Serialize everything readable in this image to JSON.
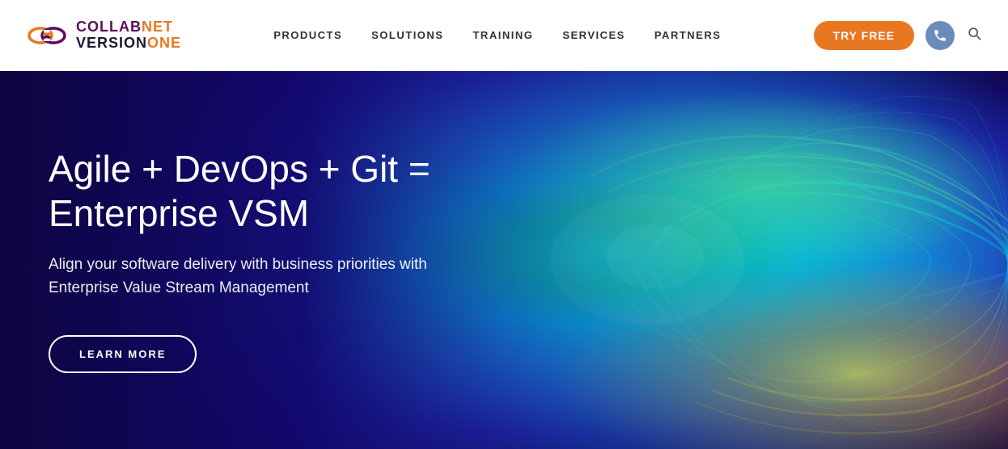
{
  "header": {
    "logo": {
      "collab": "COLLAB",
      "net": "NET",
      "version": "VERSION",
      "one": "ONE"
    },
    "nav": {
      "items": [
        {
          "label": "PRODUCTS",
          "id": "products"
        },
        {
          "label": "SOLUTIONS",
          "id": "solutions"
        },
        {
          "label": "TRAINING",
          "id": "training"
        },
        {
          "label": "SERVICES",
          "id": "services"
        },
        {
          "label": "PARTNERS",
          "id": "partners"
        }
      ]
    },
    "try_free_label": "TRY FREE",
    "phone_icon": "phone",
    "search_icon": "search"
  },
  "hero": {
    "title": "Agile + DevOps + Git = Enterprise VSM",
    "subtitle": "Align your software delivery with business priorities with Enterprise Value Stream Management",
    "cta_label": "LEARN MORE"
  }
}
